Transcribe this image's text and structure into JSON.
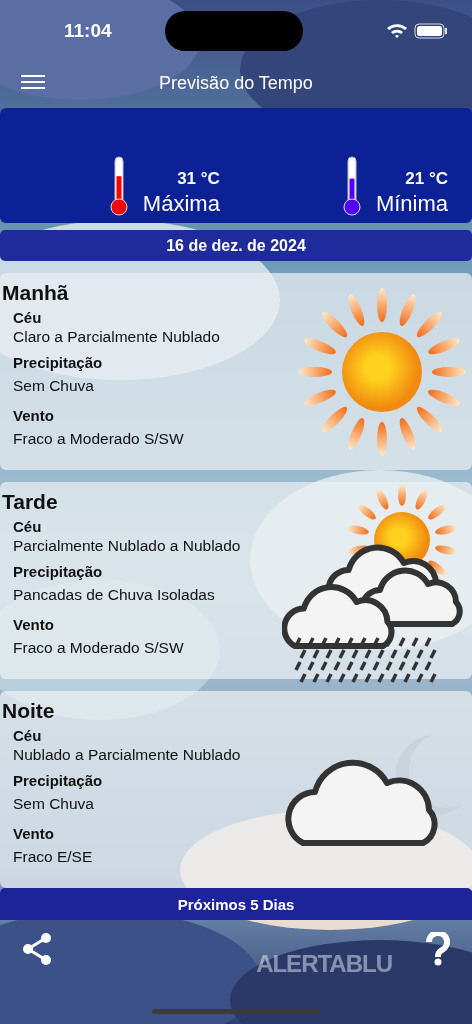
{
  "status_bar": {
    "time": "11:04"
  },
  "nav": {
    "title": "Previsão do Tempo"
  },
  "temperatures": [
    {
      "kind": "max",
      "value": "31 °C",
      "label": "Máxima",
      "color": "#ff0000"
    },
    {
      "kind": "min",
      "value": "21 °C",
      "label": "Mínima",
      "color": "#5500ff"
    }
  ],
  "date": "16 de dez. de 2024",
  "periods": [
    {
      "name": "Manhã",
      "kind": "sun",
      "fields": [
        {
          "label": "Céu",
          "value": "Claro a Parcialmente Nublado"
        },
        {
          "label": "Precipitação",
          "value": "Sem Chuva"
        },
        {
          "label": "Vento",
          "value": "Fraco a Moderado S/SW"
        }
      ]
    },
    {
      "name": "Tarde",
      "kind": "sun-rain",
      "fields": [
        {
          "label": "Céu",
          "value": "Parcialmente Nublado a Nublado"
        },
        {
          "label": "Precipitação",
          "value": "Pancadas de Chuva Isoladas"
        },
        {
          "label": "Vento",
          "value": "Fraco a Moderado S/SW"
        }
      ]
    },
    {
      "name": "Noite",
      "kind": "moon-cloud",
      "fields": [
        {
          "label": "Céu",
          "value": "Nublado a Parcialmente Nublado"
        },
        {
          "label": "Precipitação",
          "value": "Sem Chuva"
        },
        {
          "label": "Vento",
          "value": "Fraco E/SE"
        }
      ]
    }
  ],
  "next_days_button": "Próximos 5 Dias",
  "toolbar": {
    "logo": "ALERTABLU"
  }
}
